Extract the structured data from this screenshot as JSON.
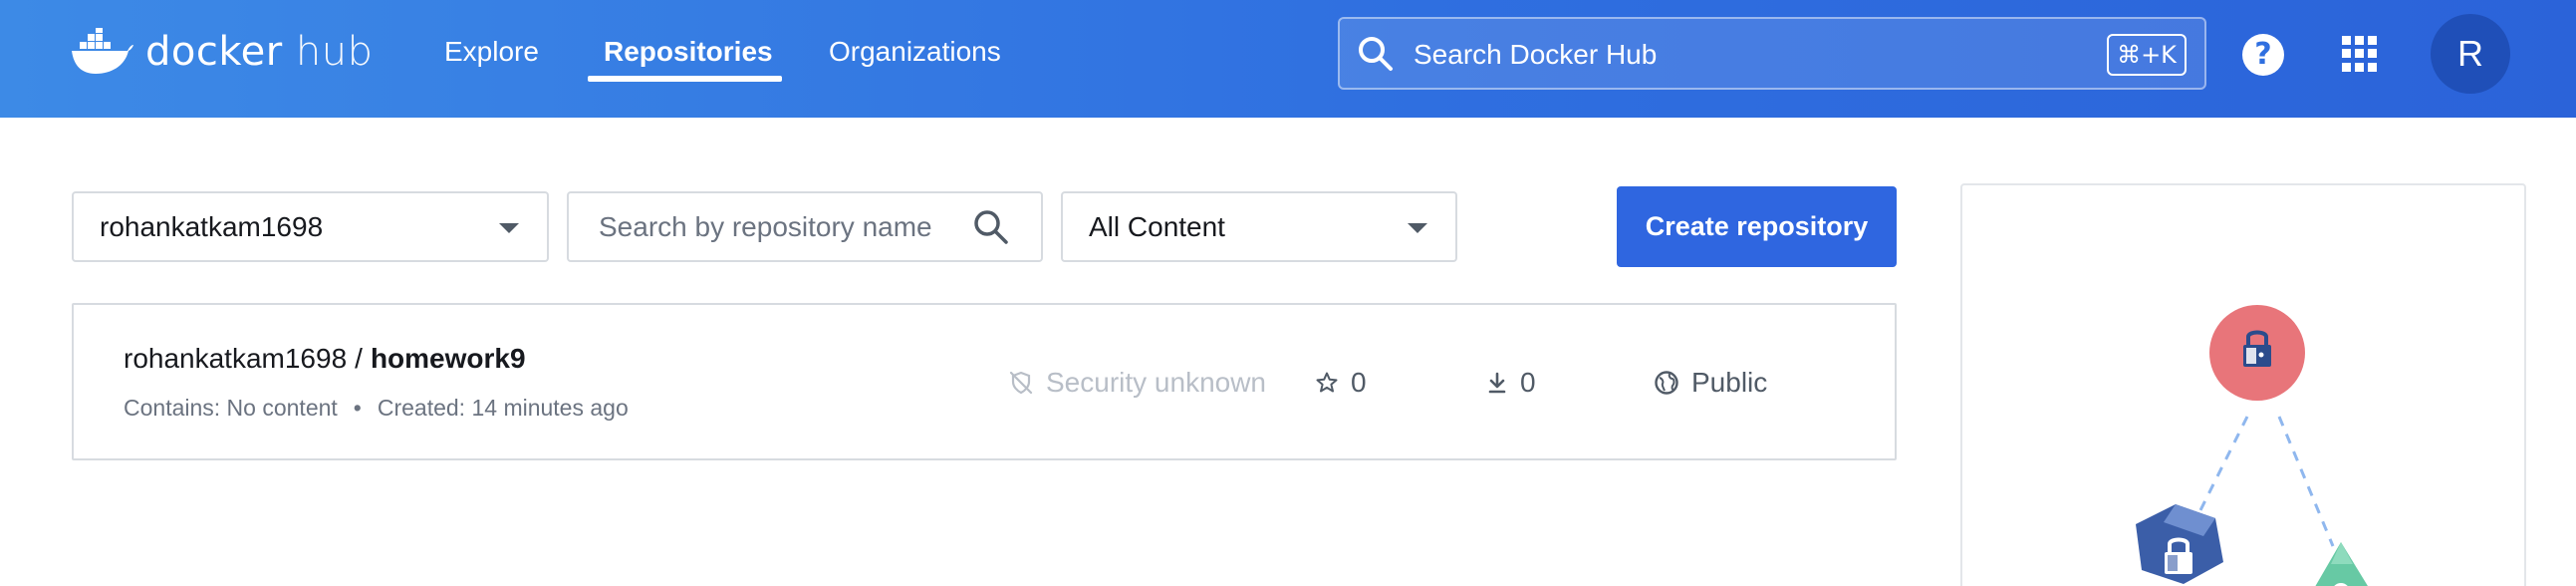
{
  "brand": {
    "name_bold": "docker",
    "name_light": "hub"
  },
  "nav": {
    "explore": "Explore",
    "repositories": "Repositories",
    "organizations": "Organizations"
  },
  "search": {
    "placeholder": "Search Docker Hub",
    "shortcut": "⌘+K"
  },
  "header": {
    "help_label": "?",
    "avatar_initial": "R"
  },
  "filters": {
    "namespace": "rohankatkam1698",
    "repo_search_placeholder": "Search by repository name",
    "content_filter": "All Content",
    "create_button": "Create repository"
  },
  "repositories": [
    {
      "namespace": "rohankatkam1698",
      "separator": "/",
      "name": "homework9",
      "contains": "Contains: No content",
      "meta_separator": "•",
      "created": "Created: 14 minutes ago",
      "security": "Security unknown",
      "stars": "0",
      "pulls": "0",
      "visibility": "Public"
    }
  ],
  "colors": {
    "header_gradient_start": "#3d8ae6",
    "header_gradient_end": "#2b63d9",
    "primary_button": "#2f66e0",
    "avatar": "#1f4fb8",
    "lock_red": "#e8757a",
    "lock_blue": "#3b5ea8",
    "lock_green": "#67c9a4"
  },
  "icons": [
    "docker-whale-icon",
    "search-icon",
    "help-icon",
    "apps-grid-icon",
    "magnifier-icon",
    "shield-off-icon",
    "star-icon",
    "download-icon",
    "globe-icon",
    "lock-icon"
  ]
}
